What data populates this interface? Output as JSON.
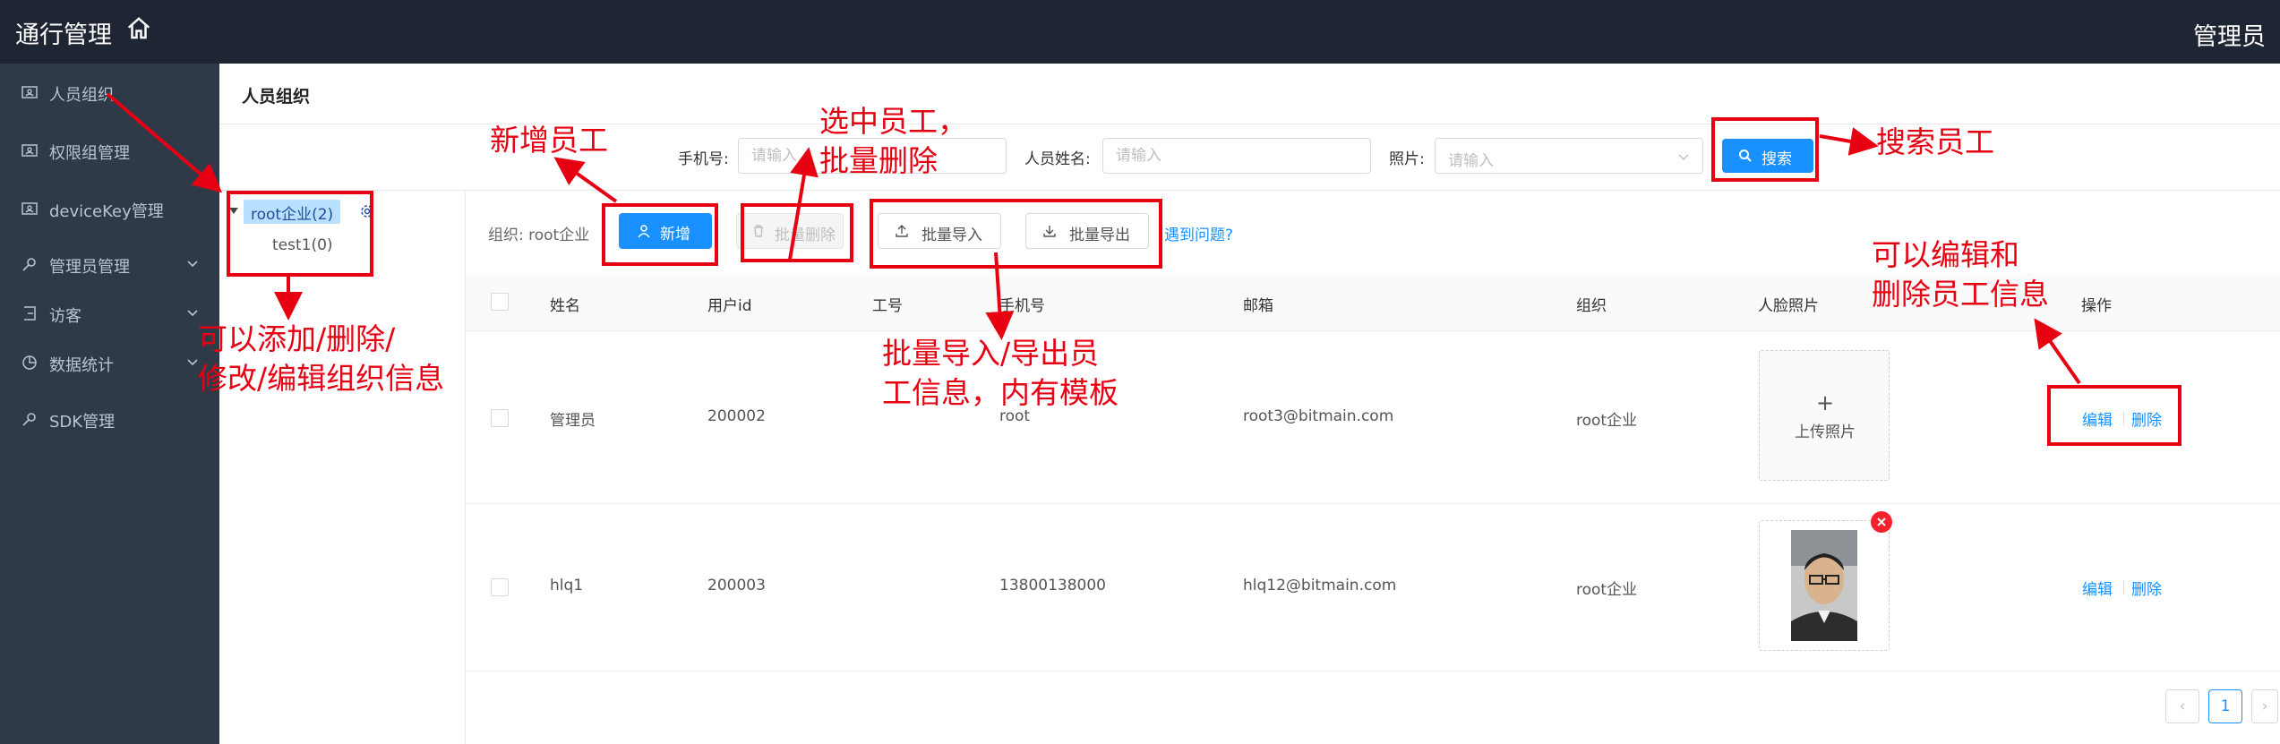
{
  "app": {
    "title": "通行管理",
    "user": "管理员"
  },
  "icons": {
    "home": "home-icon",
    "search": "search-icon",
    "user": "user-icon",
    "upload": "upload-icon",
    "download": "download-icon",
    "gear": "gear-icon",
    "delete": "trash-icon"
  },
  "sidebar": {
    "items": [
      {
        "label": "人员组织",
        "icon": "id-card-icon",
        "expandable": false
      },
      {
        "label": "权限组管理",
        "icon": "id-card-icon",
        "expandable": false
      },
      {
        "label": "deviceKey管理",
        "icon": "id-card-icon",
        "expandable": false
      },
      {
        "label": "管理员管理",
        "icon": "key-icon",
        "expandable": true
      },
      {
        "label": "访客",
        "icon": "login-icon",
        "expandable": true
      },
      {
        "label": "数据统计",
        "icon": "pie-chart-icon",
        "expandable": true
      },
      {
        "label": "SDK管理",
        "icon": "key-icon",
        "expandable": false
      }
    ]
  },
  "page": {
    "title": "人员组织"
  },
  "search": {
    "phone_label": "手机号:",
    "phone_placeholder": "请输入",
    "name_label": "人员姓名:",
    "name_placeholder": "请输入",
    "photo_label": "照片:",
    "photo_placeholder": "请输入",
    "button_label": "搜索"
  },
  "tree": {
    "root": "root企业(2)",
    "children": [
      "test1(0)"
    ]
  },
  "toolbar": {
    "org_label": "组织: root企业",
    "add_label": "新增",
    "batch_delete_label": "批量删除",
    "import_label": "批量导入",
    "export_label": "批量导出",
    "help_link": "遇到问题?"
  },
  "table": {
    "columns": [
      "姓名",
      "用户id",
      "工号",
      "手机号",
      "邮箱",
      "组织",
      "人脸照片",
      "操作"
    ],
    "rows": [
      {
        "name": "管理员",
        "user_id": "200002",
        "employee_no": "",
        "phone": "root",
        "email": "root3@bitmain.com",
        "org": "root企业",
        "photo": "",
        "upload_label": "上传照片",
        "edit": "编辑",
        "delete": "删除"
      },
      {
        "name": "hlq1",
        "user_id": "200003",
        "employee_no": "",
        "phone": "13800138000",
        "email": "hlq12@bitmain.com",
        "org": "root企业",
        "photo": "face-photo",
        "edit": "编辑",
        "delete": "删除"
      }
    ]
  },
  "pagination": {
    "current": "1"
  },
  "annotations": {
    "add_employee": "新增员工",
    "batch_delete": "选中员工，\n批量删除",
    "search_employee": "搜索员工",
    "org_info": "可以添加/删除/\n修改/编辑组织信息",
    "import_export": "批量导入/导出员\n工信息，内有模板",
    "edit_delete": "可以编辑和\n删除员工信息"
  },
  "colors": {
    "primary": "#1890ff",
    "annotation": "#e60012",
    "topbar": "#1f2633",
    "sidebar": "#2f3a49"
  }
}
